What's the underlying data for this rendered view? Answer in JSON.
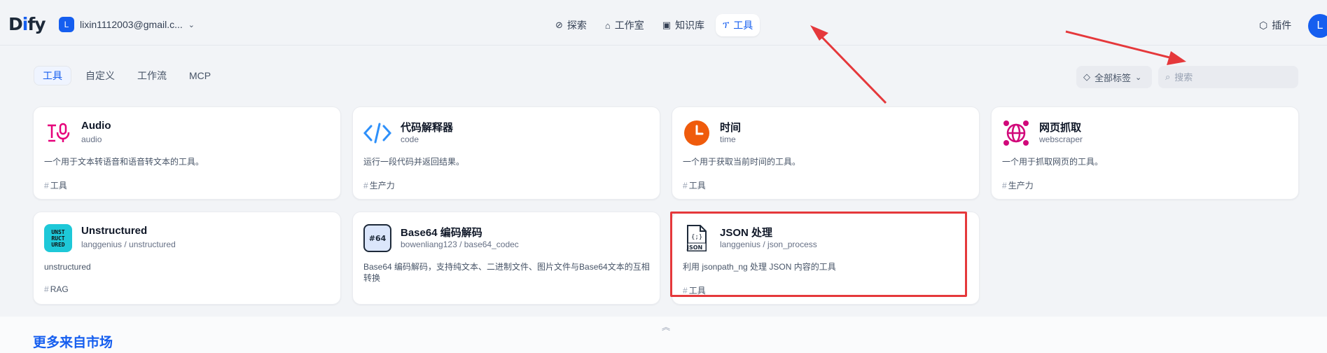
{
  "header": {
    "logo": {
      "prefix": "D",
      "accent": "i",
      "suffix": "fy"
    },
    "account": {
      "avatar_letter": "L",
      "email": "lixin1112003@gmail.c..."
    },
    "nav": [
      {
        "label": "探索",
        "icon": "compass-icon",
        "active": false
      },
      {
        "label": "工作室",
        "icon": "robot-icon",
        "active": false
      },
      {
        "label": "知识库",
        "icon": "book-icon",
        "active": false
      },
      {
        "label": "工具",
        "icon": "tool-icon",
        "active": true
      }
    ],
    "plugin_label": "插件",
    "user_avatar_letter": "L"
  },
  "subtabs": [
    {
      "label": "工具",
      "active": true
    },
    {
      "label": "自定义",
      "active": false
    },
    {
      "label": "工作流",
      "active": false
    },
    {
      "label": "MCP",
      "active": false
    }
  ],
  "filter": {
    "tags_label": "全部标签",
    "search_placeholder": "搜索"
  },
  "cards": [
    {
      "name": "Audio",
      "org": "audio",
      "desc": "一个用于文本转语音和语音转文本的工具。",
      "tag": "工具",
      "icon": "audio-icon",
      "icon_color": "#e6007a"
    },
    {
      "name": "代码解释器",
      "org": "code",
      "desc": "运行一段代码并返回结果。",
      "tag": "生产力",
      "icon": "code-icon",
      "icon_color": "#2e90fa"
    },
    {
      "name": "时间",
      "org": "time",
      "desc": "一个用于获取当前时间的工具。",
      "tag": "工具",
      "icon": "clock-icon",
      "icon_color": "#ef5b0c"
    },
    {
      "name": "网页抓取",
      "org": "webscraper",
      "desc": "一个用于抓取网页的工具。",
      "tag": "生产力",
      "icon": "web-icon",
      "icon_color": "#d1087a"
    },
    {
      "name": "Unstructured",
      "org": "langgenius / unstructured",
      "desc": "unstructured",
      "tag": "RAG",
      "icon": "unstructured-icon",
      "icon_color": "#1ec8d8",
      "logo_text": "UNST RUCT URED"
    },
    {
      "name": "Base64 编码解码",
      "org": "bowenliang123 / base64_codec",
      "desc": "Base64 编码解码，支持纯文本、二进制文件、图片文件与Base64文本的互相转换",
      "tag": "工具",
      "icon": "base64-icon",
      "icon_color": "#1d2939",
      "logo_text": "#64"
    },
    {
      "name": "JSON 处理",
      "org": "langgenius / json_process",
      "desc": "利用 jsonpath_ng 处理 JSON 内容的工具",
      "tag": "工具",
      "icon": "json-icon",
      "icon_color": "#1d2939",
      "logo_text": "JSON"
    }
  ],
  "footer": {
    "collapse_icon": "chevrons-up-icon",
    "more_title": "更多来自市场"
  },
  "colors": {
    "accent": "#155eef",
    "annotation": "#e5383b"
  }
}
